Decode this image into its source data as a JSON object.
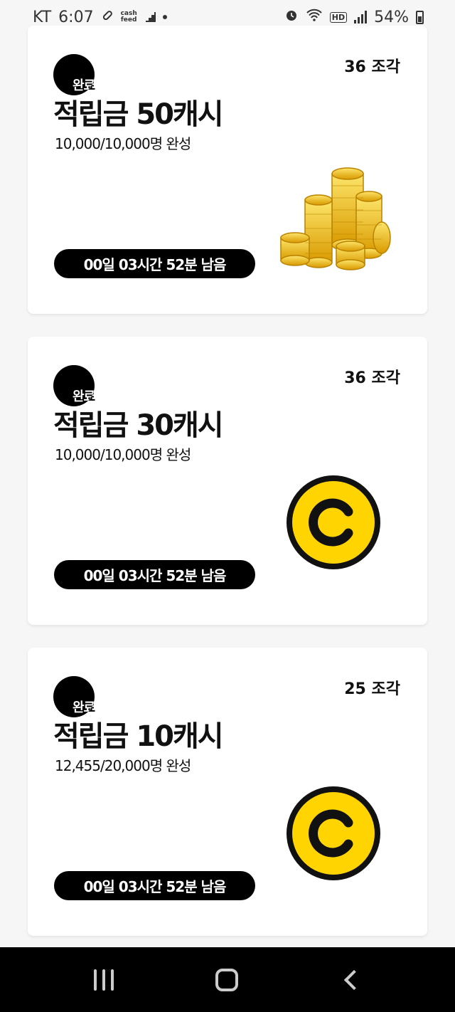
{
  "status_bar": {
    "carrier": "KT",
    "time": "6:07",
    "app_label_top": "cash",
    "app_label_bottom": "feed",
    "network": "HD",
    "battery": "54%"
  },
  "cards": [
    {
      "badge": "완료",
      "pieces": "36 조각",
      "title": "적립금 50캐시",
      "progress": "10,000/10,000명 완성",
      "timer": "00일 03시간 52분 남음",
      "image": "gold-coins-stack"
    },
    {
      "badge": "완료",
      "pieces": "36 조각",
      "title": "적립금 30캐시",
      "progress": "10,000/10,000명 완성",
      "timer": "00일 03시간 52분 남음",
      "image": "yellow-c-coin"
    },
    {
      "badge": "완료",
      "pieces": "25 조각",
      "title": "적립금 10캐시",
      "progress": "12,455/20,000명 완성",
      "timer": "00일 03시간 52분 남음",
      "image": "yellow-c-coin"
    }
  ],
  "colors": {
    "coin_yellow": "#ffd400",
    "gold": "#e9b50f",
    "black": "#000000",
    "background": "#f6f6f6"
  }
}
